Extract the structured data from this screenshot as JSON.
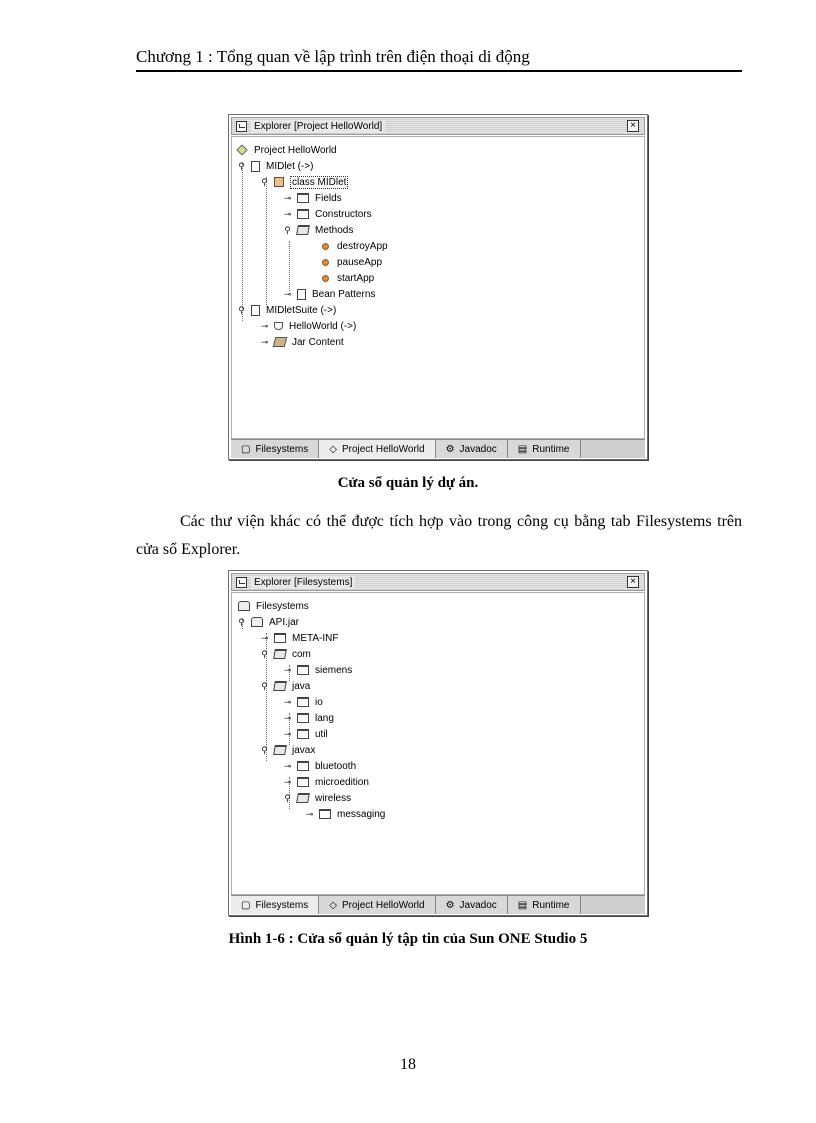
{
  "header": {
    "title": "Chương 1 : Tổng quan về lập trình trên điện thoại di động"
  },
  "window1": {
    "title": "Explorer [Project HelloWorld]",
    "close": "×",
    "tree": [
      {
        "label": "Project HelloWorld",
        "handle": "",
        "icon": "diamond-icon"
      },
      {
        "label": "MIDlet (->)",
        "handle": "⚲",
        "icon": "midlet-icon"
      },
      {
        "label": "class MIDlet",
        "handle": "⚲",
        "icon": "class-icon"
      },
      {
        "label": "Fields",
        "handle": "⊸",
        "icon": "fields-icon"
      },
      {
        "label": "Constructors",
        "handle": "⊸",
        "icon": "constructors-icon"
      },
      {
        "label": "Methods",
        "handle": "⚲",
        "icon": "methods-icon"
      },
      {
        "label": "destroyApp",
        "handle": "",
        "icon": "method-dot-icon"
      },
      {
        "label": "pauseApp",
        "handle": "",
        "icon": "method-dot-icon"
      },
      {
        "label": "startApp",
        "handle": "",
        "icon": "method-dot-icon"
      },
      {
        "label": "Bean Patterns",
        "handle": "⊸",
        "icon": "bean-icon"
      },
      {
        "label": "MIDletSuite (->)",
        "handle": "⚲",
        "icon": "suite-icon"
      },
      {
        "label": "HelloWorld (->)",
        "handle": "⊸",
        "icon": "cup-icon"
      },
      {
        "label": "Jar Content",
        "handle": "⊸",
        "icon": "jar-icon"
      }
    ],
    "tabs": [
      {
        "label": "Filesystems",
        "icon": "filesystems-icon",
        "active": false
      },
      {
        "label": "Project HelloWorld",
        "icon": "project-icon",
        "active": true
      },
      {
        "label": "Javadoc",
        "icon": "javadoc-icon",
        "active": false
      },
      {
        "label": "Runtime",
        "icon": "runtime-icon",
        "active": false
      }
    ]
  },
  "caption1": "Cửa sổ quản lý dự án.",
  "paragraph": "Các thư viện khác có thể được tích hợp vào trong công cụ bằng tab Filesystems trên cửa sổ Explorer.",
  "window2": {
    "title": "Explorer [Filesystems]",
    "close": "×",
    "tree": [
      {
        "label": "Filesystems",
        "handle": "",
        "icon": "filesystems-root-icon"
      },
      {
        "label": "API.jar",
        "handle": "⚲",
        "icon": "disk-icon"
      },
      {
        "label": "META-INF",
        "handle": "⊸",
        "icon": "folder-icon"
      },
      {
        "label": "com",
        "handle": "⚲",
        "icon": "folder-open-icon"
      },
      {
        "label": "siemens",
        "handle": "⊸",
        "icon": "folder-icon"
      },
      {
        "label": "java",
        "handle": "⚲",
        "icon": "folder-open-icon"
      },
      {
        "label": "io",
        "handle": "⊸",
        "icon": "folder-icon"
      },
      {
        "label": "lang",
        "handle": "⊸",
        "icon": "folder-icon"
      },
      {
        "label": "util",
        "handle": "⊸",
        "icon": "folder-icon"
      },
      {
        "label": "javax",
        "handle": "⚲",
        "icon": "folder-open-icon"
      },
      {
        "label": "bluetooth",
        "handle": "⊸",
        "icon": "folder-icon"
      },
      {
        "label": "microedition",
        "handle": "⊸",
        "icon": "folder-icon"
      },
      {
        "label": "wireless",
        "handle": "⚲",
        "icon": "folder-open-icon"
      },
      {
        "label": "messaging",
        "handle": "⊸",
        "icon": "folder-icon"
      }
    ],
    "tabs": [
      {
        "label": "Filesystems",
        "icon": "filesystems-icon",
        "active": true
      },
      {
        "label": "Project HelloWorld",
        "icon": "project-icon",
        "active": false
      },
      {
        "label": "Javadoc",
        "icon": "javadoc-icon",
        "active": false
      },
      {
        "label": "Runtime",
        "icon": "runtime-icon",
        "active": false
      }
    ]
  },
  "caption2": "Hình 1-6 : Cửa sổ quản lý tập tin của Sun ONE Studio 5",
  "page_number": "18"
}
